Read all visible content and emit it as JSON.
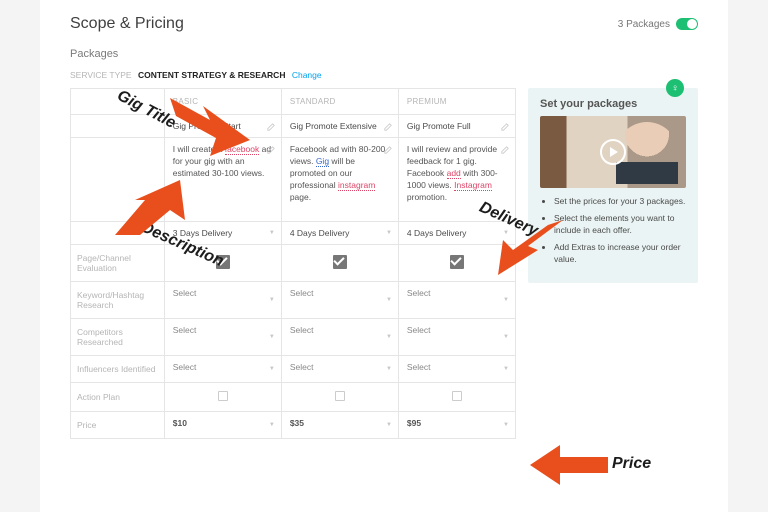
{
  "header": {
    "title": "Scope & Pricing",
    "packages_label": "3 Packages"
  },
  "section": "Packages",
  "service": {
    "label": "SERVICE TYPE",
    "value": "CONTENT STRATEGY & RESEARCH",
    "change": "Change"
  },
  "tiers": [
    "BASIC",
    "STANDARD",
    "PREMIUM"
  ],
  "titles": [
    "Gig Promote Start",
    "Gig Promote Extensive",
    "Gig Promote Full"
  ],
  "descs": {
    "basic": [
      "I will create a ",
      "facebook",
      " ad for your gig with an estimated 30-100 views."
    ],
    "standard": [
      "Facebook ad with 80-200 views.\n",
      "Gig",
      " will be promoted on our professional ",
      "instagram",
      " page."
    ],
    "premium": [
      "I will review and provide feedback for 1 gig. Facebook ",
      "add",
      " with 300-1000 views. ",
      "Instagram",
      " promotion."
    ]
  },
  "delivery": [
    "3 Days Delivery",
    "4 Days Delivery",
    "4 Days Delivery"
  ],
  "rows": {
    "page_eval": "Page/Channel Evaluation",
    "keyword": "Keyword/Hashtag Research",
    "competitors": "Competitors Researched",
    "influencers": "Influencers Identified",
    "action_plan": "Action Plan",
    "price": "Price"
  },
  "select_label": "Select",
  "prices": [
    "$10",
    "$35",
    "$95"
  ],
  "tip": {
    "title": "Set your packages",
    "items": [
      "Set the prices for your 3 packages.",
      "Select the elements you want to include in each offer.",
      "Add Extras to increase your order value."
    ]
  },
  "annotations": {
    "gig_title": "Gig Title",
    "description": "Description",
    "delivery": "Delivery",
    "price": "Price"
  }
}
